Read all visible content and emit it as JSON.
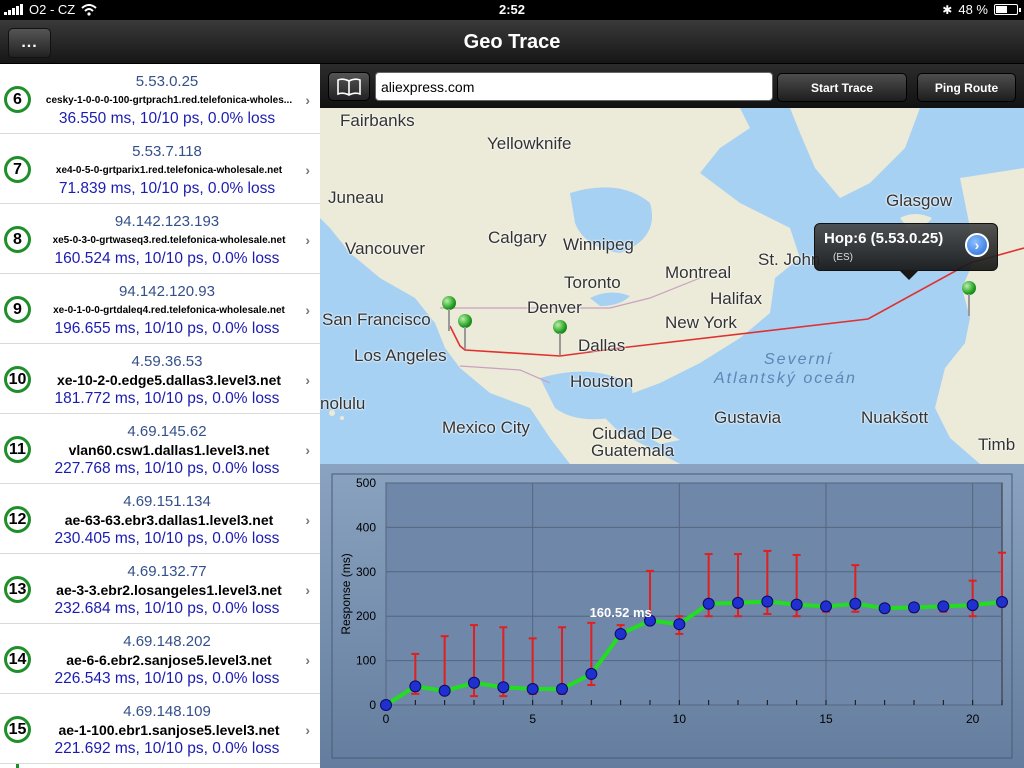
{
  "status": {
    "carrier": "O2 - CZ",
    "time": "2:52",
    "battery": "48 %",
    "battery_level": 0.48
  },
  "nav": {
    "title": "Geo Trace",
    "menu_label": "..."
  },
  "toolbar": {
    "url_value": "aliexpress.com",
    "start_label": "Start Trace",
    "ping_label": "Ping Route"
  },
  "hops": [
    {
      "num": "6",
      "ip": "5.53.0.25",
      "host": "cesky-1-0-0-0-100-grtprach1.red.telefonica-wholes...",
      "stats": "36.550 ms, 10/10 ps, 0.0% loss",
      "large": false
    },
    {
      "num": "7",
      "ip": "5.53.7.118",
      "host": "xe4-0-5-0-grtparix1.red.telefonica-wholesale.net",
      "stats": "71.839 ms, 10/10 ps, 0.0% loss",
      "large": false
    },
    {
      "num": "8",
      "ip": "94.142.123.193",
      "host": "xe5-0-3-0-grtwaseq3.red.telefonica-wholesale.net",
      "stats": "160.524 ms, 10/10 ps, 0.0% loss",
      "large": false
    },
    {
      "num": "9",
      "ip": "94.142.120.93",
      "host": "xe-0-1-0-0-grtdaleq4.red.telefonica-wholesale.net",
      "stats": "196.655 ms, 10/10 ps, 0.0% loss",
      "large": false
    },
    {
      "num": "10",
      "ip": "4.59.36.53",
      "host": "xe-10-2-0.edge5.dallas3.level3.net",
      "stats": "181.772 ms, 10/10 ps, 0.0% loss",
      "large": true
    },
    {
      "num": "11",
      "ip": "4.69.145.62",
      "host": "vlan60.csw1.dallas1.level3.net",
      "stats": "227.768 ms, 10/10 ps, 0.0% loss",
      "large": true
    },
    {
      "num": "12",
      "ip": "4.69.151.134",
      "host": "ae-63-63.ebr3.dallas1.level3.net",
      "stats": "230.405 ms, 10/10 ps, 0.0% loss",
      "large": true
    },
    {
      "num": "13",
      "ip": "4.69.132.77",
      "host": "ae-3-3.ebr2.losangeles1.level3.net",
      "stats": "232.684 ms, 10/10 ps, 0.0% loss",
      "large": true
    },
    {
      "num": "14",
      "ip": "4.69.148.202",
      "host": "ae-6-6.ebr2.sanjose5.level3.net",
      "stats": "226.543 ms, 10/10 ps, 0.0% loss",
      "large": true
    },
    {
      "num": "15",
      "ip": "4.69.148.109",
      "host": "ae-1-100.ebr1.sanjose5.level3.net",
      "stats": "221.692 ms, 10/10 ps, 0.0% loss",
      "large": true
    }
  ],
  "map": {
    "cities": [
      "Fairbanks",
      "Yellowknife",
      "Juneau",
      "Glasgow",
      "Calgary",
      "Winnipeg",
      "Vancouver",
      "Montreal",
      "St. John",
      "Toronto",
      "Halifax",
      "Denver",
      "New York",
      "San Francisco",
      "Los Angeles",
      "Dallas",
      "Houston",
      "nolulu",
      "Mexico City",
      "Gustavia",
      "Nuakšott",
      "Ciudad De",
      "Guatemala",
      "Timb"
    ],
    "ocean_line1": "Severní",
    "ocean_line2": "Atlantský oceán",
    "callout_title": "Hop:6 (5.53.0.25)",
    "callout_sub": "(ES)",
    "route_color": "#e03030",
    "land_color": "#ecead8",
    "water_color": "#a7d1f2"
  },
  "chart_data": {
    "type": "line",
    "ylabel": "Response (ms)",
    "xlim": [
      0,
      21
    ],
    "ylim": [
      0,
      500
    ],
    "xticks": [
      0,
      5,
      10,
      15,
      20
    ],
    "yticks": [
      0,
      100,
      200,
      300,
      400,
      500
    ],
    "grid": true,
    "highlight_label": "160.52 ms",
    "highlight_index": 8,
    "series": [
      {
        "x": [
          0,
          1,
          2,
          3,
          4,
          5,
          6,
          7,
          8,
          9,
          10,
          11,
          12,
          13,
          14,
          15,
          16,
          17,
          18,
          19,
          20,
          21
        ],
        "values": [
          0,
          42,
          32,
          50,
          40,
          36,
          36,
          70,
          160,
          190,
          182,
          228,
          230,
          233,
          226,
          222,
          228,
          218,
          220,
          222,
          225,
          232
        ],
        "err_low": [
          0,
          25,
          25,
          20,
          20,
          25,
          25,
          45,
          150,
          185,
          160,
          200,
          200,
          205,
          200,
          210,
          210,
          210,
          210,
          210,
          200,
          222
        ],
        "err_high": [
          0,
          115,
          155,
          180,
          175,
          150,
          175,
          185,
          180,
          302,
          200,
          340,
          340,
          347,
          338,
          230,
          315,
          225,
          225,
          225,
          280,
          343
        ],
        "line_color": "#22dd22",
        "marker_color": "#1f2fd0",
        "error_color": "#e02020"
      }
    ]
  }
}
